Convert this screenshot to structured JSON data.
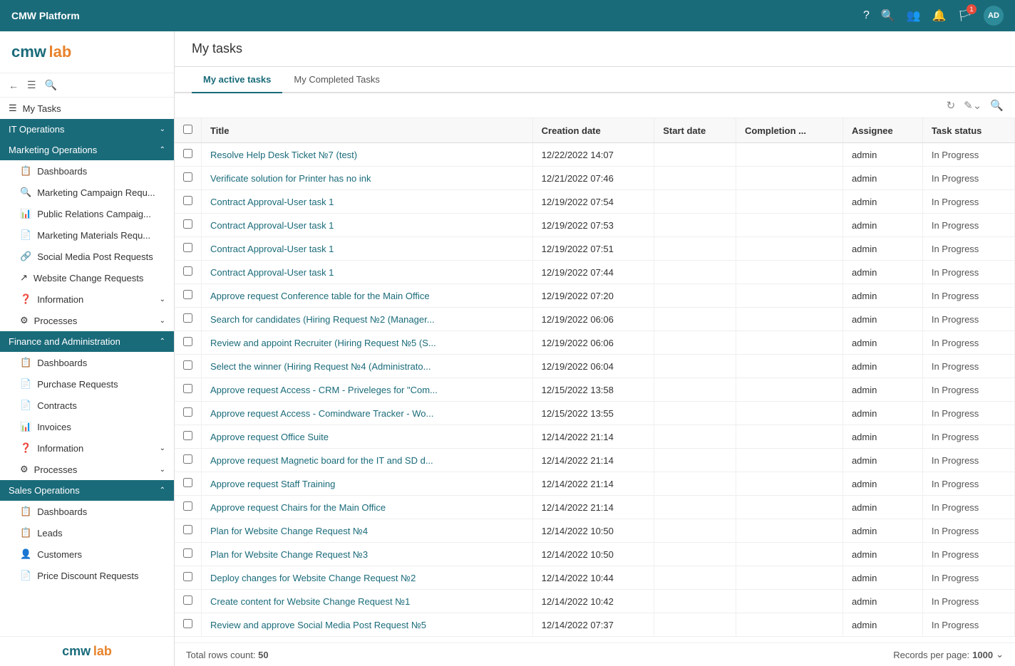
{
  "topbar": {
    "title": "CMW Platform",
    "avatar_label": "AD",
    "notification_count": "1"
  },
  "sidebar": {
    "logo_cmw": "cmw",
    "logo_lab": "lab",
    "my_tasks_label": "My Tasks",
    "sections": [
      {
        "id": "it-operations",
        "label": "IT Operations",
        "active": false,
        "collapsed": true
      },
      {
        "id": "marketing-operations",
        "label": "Marketing Operations",
        "active": true,
        "collapsed": false,
        "items": [
          {
            "id": "dashboards-mkt",
            "label": "Dashboards",
            "icon": "📋"
          },
          {
            "id": "marketing-campaign",
            "label": "Marketing Campaign Requ...",
            "icon": "🔍"
          },
          {
            "id": "public-relations",
            "label": "Public Relations Campaig...",
            "icon": "📊"
          },
          {
            "id": "marketing-materials",
            "label": "Marketing Materials Requ...",
            "icon": "📄"
          },
          {
            "id": "social-media",
            "label": "Social Media Post Requests",
            "icon": "🔗"
          },
          {
            "id": "website-change",
            "label": "Website Change Requests",
            "icon": "↗"
          },
          {
            "id": "information-mkt",
            "label": "Information",
            "icon": "❓",
            "has_children": true
          },
          {
            "id": "processes-mkt",
            "label": "Processes",
            "icon": "⚙",
            "has_children": true
          }
        ]
      },
      {
        "id": "finance-admin",
        "label": "Finance and Administration",
        "active": true,
        "collapsed": false,
        "items": [
          {
            "id": "dashboards-fin",
            "label": "Dashboards",
            "icon": "📋"
          },
          {
            "id": "purchase-requests",
            "label": "Purchase Requests",
            "icon": "📄"
          },
          {
            "id": "contracts",
            "label": "Contracts",
            "icon": "📄"
          },
          {
            "id": "invoices",
            "label": "Invoices",
            "icon": "📊"
          },
          {
            "id": "information-fin",
            "label": "Information",
            "icon": "❓",
            "has_children": true
          },
          {
            "id": "processes-fin",
            "label": "Processes",
            "icon": "⚙",
            "has_children": true
          }
        ]
      },
      {
        "id": "sales-operations",
        "label": "Sales Operations",
        "active": true,
        "collapsed": false,
        "items": [
          {
            "id": "dashboards-sales",
            "label": "Dashboards",
            "icon": "📋"
          },
          {
            "id": "leads",
            "label": "Leads",
            "icon": "📋"
          },
          {
            "id": "customers",
            "label": "Customers",
            "icon": "👤"
          },
          {
            "id": "price-discount",
            "label": "Price Discount Requests",
            "icon": "📄"
          }
        ]
      }
    ],
    "footer_cmw": "cmw",
    "footer_lab": "lab"
  },
  "page": {
    "title": "My tasks",
    "tabs": [
      {
        "id": "active",
        "label": "My active tasks",
        "active": true
      },
      {
        "id": "completed",
        "label": "My Completed Tasks",
        "active": false
      }
    ]
  },
  "table": {
    "columns": [
      {
        "id": "check",
        "label": ""
      },
      {
        "id": "title",
        "label": "Title"
      },
      {
        "id": "creation_date",
        "label": "Creation date"
      },
      {
        "id": "start_date",
        "label": "Start date"
      },
      {
        "id": "completion",
        "label": "Completion ..."
      },
      {
        "id": "assignee",
        "label": "Assignee"
      },
      {
        "id": "status",
        "label": "Task status"
      }
    ],
    "rows": [
      {
        "title": "Resolve Help Desk Ticket №7 (test)",
        "creation_date": "12/22/2022 14:07",
        "start_date": "",
        "completion": "",
        "assignee": "admin",
        "status": "In Progress"
      },
      {
        "title": "Verificate solution for Printer has no ink",
        "creation_date": "12/21/2022 07:46",
        "start_date": "",
        "completion": "",
        "assignee": "admin",
        "status": "In Progress"
      },
      {
        "title": "Contract Approval-User task 1",
        "creation_date": "12/19/2022 07:54",
        "start_date": "",
        "completion": "",
        "assignee": "admin",
        "status": "In Progress"
      },
      {
        "title": "Contract Approval-User task 1",
        "creation_date": "12/19/2022 07:53",
        "start_date": "",
        "completion": "",
        "assignee": "admin",
        "status": "In Progress"
      },
      {
        "title": "Contract Approval-User task 1",
        "creation_date": "12/19/2022 07:51",
        "start_date": "",
        "completion": "",
        "assignee": "admin",
        "status": "In Progress"
      },
      {
        "title": "Contract Approval-User task 1",
        "creation_date": "12/19/2022 07:44",
        "start_date": "",
        "completion": "",
        "assignee": "admin",
        "status": "In Progress"
      },
      {
        "title": "Approve request Conference table for the Main Office",
        "creation_date": "12/19/2022 07:20",
        "start_date": "",
        "completion": "",
        "assignee": "admin",
        "status": "In Progress"
      },
      {
        "title": "Search for candidates (Hiring Request №2 (Manager...",
        "creation_date": "12/19/2022 06:06",
        "start_date": "",
        "completion": "",
        "assignee": "admin",
        "status": "In Progress"
      },
      {
        "title": "Review and appoint Recruiter (Hiring Request №5 (S...",
        "creation_date": "12/19/2022 06:06",
        "start_date": "",
        "completion": "",
        "assignee": "admin",
        "status": "In Progress"
      },
      {
        "title": "Select the winner (Hiring Request №4 (Administrato...",
        "creation_date": "12/19/2022 06:04",
        "start_date": "",
        "completion": "",
        "assignee": "admin",
        "status": "In Progress"
      },
      {
        "title": "Approve request Access - CRM - Priveleges for \"Com...",
        "creation_date": "12/15/2022 13:58",
        "start_date": "",
        "completion": "",
        "assignee": "admin",
        "status": "In Progress"
      },
      {
        "title": "Approve request Access - Comindware Tracker - Wo...",
        "creation_date": "12/15/2022 13:55",
        "start_date": "",
        "completion": "",
        "assignee": "admin",
        "status": "In Progress"
      },
      {
        "title": "Approve request Office Suite",
        "creation_date": "12/14/2022 21:14",
        "start_date": "",
        "completion": "",
        "assignee": "admin",
        "status": "In Progress"
      },
      {
        "title": "Approve request Magnetic board for the IT and SD d...",
        "creation_date": "12/14/2022 21:14",
        "start_date": "",
        "completion": "",
        "assignee": "admin",
        "status": "In Progress"
      },
      {
        "title": "Approve request Staff Training",
        "creation_date": "12/14/2022 21:14",
        "start_date": "",
        "completion": "",
        "assignee": "admin",
        "status": "In Progress"
      },
      {
        "title": "Approve request Chairs for the Main Office",
        "creation_date": "12/14/2022 21:14",
        "start_date": "",
        "completion": "",
        "assignee": "admin",
        "status": "In Progress"
      },
      {
        "title": "Plan for Website Change Request №4",
        "creation_date": "12/14/2022 10:50",
        "start_date": "",
        "completion": "",
        "assignee": "admin",
        "status": "In Progress"
      },
      {
        "title": "Plan for Website Change Request №3",
        "creation_date": "12/14/2022 10:50",
        "start_date": "",
        "completion": "",
        "assignee": "admin",
        "status": "In Progress"
      },
      {
        "title": "Deploy changes for Website Change Request №2",
        "creation_date": "12/14/2022 10:44",
        "start_date": "",
        "completion": "",
        "assignee": "admin",
        "status": "In Progress"
      },
      {
        "title": "Create content for Website Change Request №1",
        "creation_date": "12/14/2022 10:42",
        "start_date": "",
        "completion": "",
        "assignee": "admin",
        "status": "In Progress"
      },
      {
        "title": "Review and approve Social Media Post Request №5",
        "creation_date": "12/14/2022 07:37",
        "start_date": "",
        "completion": "",
        "assignee": "admin",
        "status": "In Progress"
      }
    ],
    "total_rows_label": "Total rows count:",
    "total_rows_count": "50",
    "records_per_page_label": "Records per page:",
    "records_per_page_value": "1000"
  }
}
